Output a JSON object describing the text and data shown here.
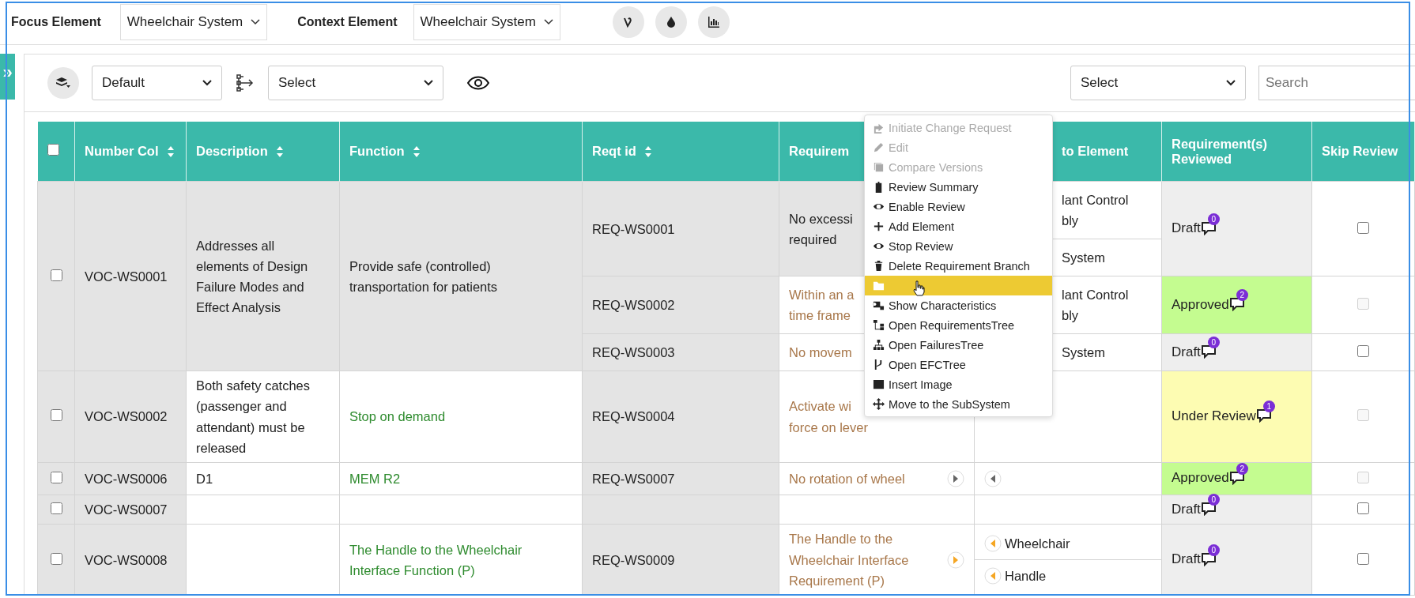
{
  "topbar": {
    "focus_label": "Focus Element",
    "focus_value": "Wheelchair System",
    "context_label": "Context Element",
    "context_value": "Wheelchair System"
  },
  "sidebar_toggle": "»",
  "toolbar": {
    "view_value": "Default",
    "tree_value": "Select",
    "filter_value": "Select",
    "search_placeholder": "Search"
  },
  "table": {
    "select_all_checked": false,
    "columns": [
      {
        "label": "Number Col",
        "sortable": true
      },
      {
        "label": "Description",
        "sortable": true
      },
      {
        "label": "Function",
        "sortable": true
      },
      {
        "label": "Reqt id",
        "sortable": true
      },
      {
        "label": "Requirem"
      },
      {
        "label": "to Element"
      },
      {
        "label": "Requirement(s) Reviewed"
      },
      {
        "label": "Skip Review"
      }
    ],
    "rows": [
      {
        "checked": false,
        "number": "VOC-WS0001",
        "description": "Addresses all elements of Design Failure Modes and Effect Analysis",
        "function": "Provide safe (controlled) transportation for patients",
        "function_linked": false,
        "shaded": true,
        "reqs": [
          {
            "id": "REQ-WS0001",
            "text": "No excessi\nrequired",
            "linked": false,
            "shaded": true,
            "links": [
              {
                "text": "lant Control\nbly"
              },
              {
                "text": "System"
              }
            ],
            "review": {
              "kind": "draft",
              "status": "Draft",
              "comments": "0"
            },
            "skip": {
              "checked": false,
              "disabled": false
            }
          },
          {
            "id": "REQ-WS0002",
            "text": "Within an a\ntime frame",
            "linked": true,
            "shaded": false,
            "links": [
              {
                "text": "lant Control\nbly"
              }
            ],
            "review": {
              "kind": "approved",
              "status": "Approved",
              "comments": "2"
            },
            "skip": {
              "checked": false,
              "disabled": true
            }
          },
          {
            "id": "REQ-WS0003",
            "text": "No movem",
            "linked": true,
            "shaded": false,
            "links": [
              {
                "text": "System"
              }
            ],
            "review": {
              "kind": "draft",
              "status": "Draft",
              "comments": "0"
            },
            "skip": {
              "checked": false,
              "disabled": false
            }
          }
        ]
      },
      {
        "checked": false,
        "number": "VOC-WS0002",
        "description": "Both safety catches (passenger and attendant) must be released",
        "function": "Stop on demand",
        "function_linked": true,
        "shaded": false,
        "reqs": [
          {
            "id": "REQ-WS0004",
            "text": "Activate wi\nforce on lever",
            "linked": true,
            "shaded": false,
            "review": {
              "kind": "review",
              "status": "Under Review",
              "comments": "1"
            },
            "skip": {
              "checked": false,
              "disabled": true
            }
          }
        ]
      },
      {
        "checked": false,
        "number": "VOC-WS0006",
        "description": "D1",
        "function": "MEM R2",
        "function_linked": true,
        "shaded": false,
        "reqs": [
          {
            "id": "REQ-WS0007",
            "text": "No rotation of wheel",
            "linked": true,
            "arrow_active": false,
            "shaded": false,
            "links": [
              {
                "arrow_active": false
              }
            ],
            "review": {
              "kind": "approved",
              "status": "Approved",
              "comments": "2"
            },
            "skip": {
              "checked": false,
              "disabled": true
            }
          }
        ]
      },
      {
        "checked": false,
        "number": "VOC-WS0007",
        "shaded": false,
        "reqs": [
          {
            "shaded": false,
            "review": {
              "kind": "draft",
              "status": "Draft",
              "comments": "0"
            },
            "skip": {
              "checked": false,
              "disabled": false
            }
          }
        ]
      },
      {
        "checked": false,
        "number": "VOC-WS0008",
        "function": "The Handle to the Wheelchair Interface Function (P)",
        "function_linked": true,
        "shaded": false,
        "reqs": [
          {
            "id": "REQ-WS0009",
            "text": "The Handle to the Wheelchair Interface Requirement (P)",
            "linked": true,
            "arrow_active": true,
            "shaded": false,
            "links": [
              {
                "text": "Wheelchair",
                "arrow_active": true
              },
              {
                "text": "Handle",
                "arrow_active": true
              }
            ],
            "review": {
              "kind": "draft",
              "status": "Draft",
              "comments": "0"
            },
            "skip": {
              "checked": false,
              "disabled": false
            }
          }
        ]
      }
    ]
  },
  "context_menu": [
    {
      "label": "Initiate Change Request",
      "disabled": true,
      "selected": false
    },
    {
      "label": "Edit",
      "disabled": true,
      "selected": false
    },
    {
      "label": "Compare Versions",
      "disabled": true,
      "selected": false
    },
    {
      "label": "Review Summary",
      "disabled": false,
      "selected": false
    },
    {
      "label": "Enable Review",
      "disabled": false,
      "selected": false
    },
    {
      "label": "Add Element",
      "disabled": false,
      "selected": false
    },
    {
      "label": "Stop Review",
      "disabled": false,
      "selected": false
    },
    {
      "label": "Delete Requirement Branch",
      "disabled": false,
      "selected": false
    },
    {
      "disabled": false,
      "selected": true
    },
    {
      "label": "Show Characteristics",
      "disabled": false,
      "selected": false
    },
    {
      "label": "Open RequirementsTree",
      "disabled": false,
      "selected": false
    },
    {
      "label": "Open FailuresTree",
      "disabled": false,
      "selected": false
    },
    {
      "label": "Open EFCTree",
      "disabled": false,
      "selected": false
    },
    {
      "label": "Insert Image",
      "disabled": false,
      "selected": false
    },
    {
      "label": "Move to the SubSystem",
      "disabled": false,
      "selected": false
    }
  ]
}
